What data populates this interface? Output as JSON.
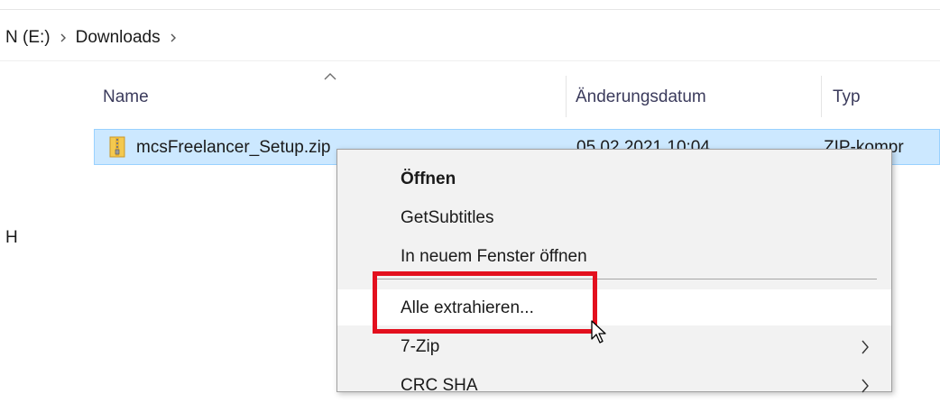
{
  "breadcrumb": {
    "items": [
      "N (E:)",
      "Downloads"
    ]
  },
  "columns": {
    "name": "Name",
    "date": "Änderungsdatum",
    "type": "Typ"
  },
  "file": {
    "name": "mcsFreelancer_Setup.zip",
    "date": "05.02.2021 10:04",
    "type": "ZIP-kompr"
  },
  "left_pane": {
    "glyph": "H"
  },
  "context_menu": {
    "items": [
      {
        "label": "Öffnen"
      },
      {
        "label": "GetSubtitles"
      },
      {
        "label": "In neuem Fenster öffnen"
      },
      {
        "label": "Alle extrahieren..."
      },
      {
        "label": "7-Zip"
      },
      {
        "label": "CRC SHA"
      }
    ]
  },
  "icons": {
    "breadcrumb_separator": "chevron-right-icon",
    "sort": "sort-ascending-icon",
    "file": "zip-folder-icon",
    "submenu": "chevron-right-icon",
    "cursor": "mouse-pointer-icon"
  },
  "colors": {
    "selection_bg": "#cce8ff",
    "selection_border": "#99d1ff",
    "menu_bg": "#f2f2f2",
    "menu_hover_bg": "#ffffff",
    "highlight": "#e3101e",
    "header_text": "#3b3b5c"
  }
}
